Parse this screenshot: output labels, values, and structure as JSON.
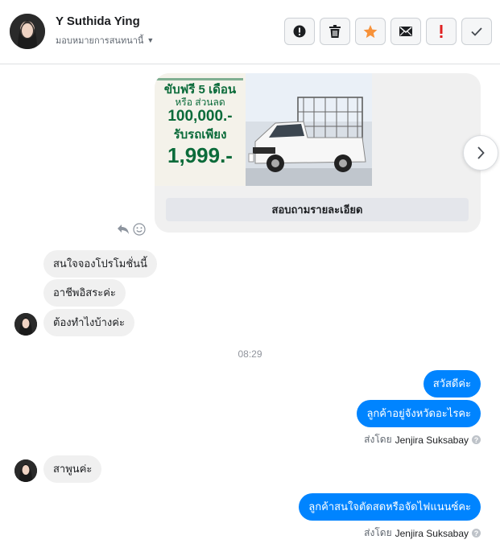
{
  "header": {
    "contact_name": "Y Suthida Ying",
    "assign_label": "มอบหมายการสนทนานี้",
    "actions": [
      "mark-spam",
      "delete",
      "star",
      "mark-unread",
      "flag",
      "mark-done"
    ]
  },
  "promo_card": {
    "ad_headline_1": "ขับฟรี 5 เดือน",
    "ad_headline_2": "หรือ ส่วนลด",
    "ad_price_1": "100,000.-",
    "ad_headline_3": "รับรถเพียง",
    "ad_price_2": "1,999.-",
    "button_label": "สอบถามรายละเอียด"
  },
  "messages_incoming_1": [
    {
      "text": "สนใจจองโปรโมชั่นนี้"
    },
    {
      "text": "อาชีพอิสระค่ะ"
    },
    {
      "text": "ต้องทำไงบ้างค่ะ"
    }
  ],
  "timestamp": "08:29",
  "messages_outgoing_1": [
    {
      "text": "สวัสดีค่ะ"
    },
    {
      "text": "ลูกค้าอยู่จังหวัดอะไรคะ"
    }
  ],
  "sent_by_1": {
    "prefix": "ส่งโดย",
    "name": "Jenjira Suksabay",
    "help": "?"
  },
  "messages_incoming_2": [
    {
      "text": "สาพูนค่ะ"
    }
  ],
  "messages_outgoing_2": [
    {
      "text": "ลูกค้าสนใจตัดสดหรือจัดไฟแนนซ์คะ"
    }
  ],
  "sent_by_2": {
    "prefix": "ส่งโดย",
    "name": "Jenjira Suksabay",
    "help": "?"
  },
  "colors": {
    "outgoing": "#0084ff",
    "incoming": "#f0f0f0",
    "star": "#f7923a",
    "flag": "#e02020",
    "ad_green": "#0b6b3a"
  }
}
